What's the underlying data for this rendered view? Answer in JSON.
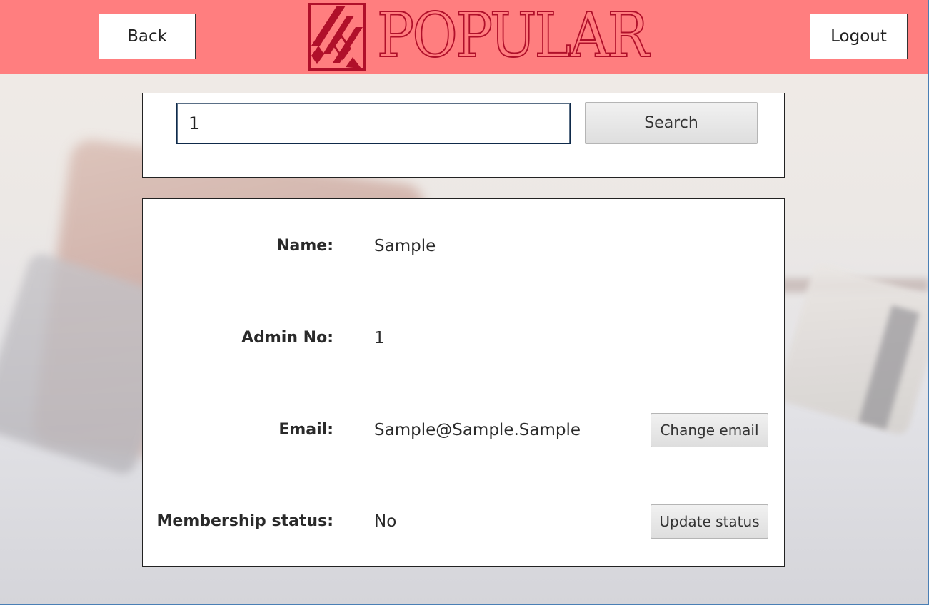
{
  "header": {
    "back_label": "Back",
    "logout_label": "Logout",
    "logo_text": "POPULAR",
    "logo_color": "#b0102a",
    "bar_color": "#ff7e7f"
  },
  "search": {
    "value": "1",
    "button_label": "Search"
  },
  "details": {
    "name": {
      "label": "Name:",
      "value": "Sample"
    },
    "admin_no": {
      "label": "Admin No:",
      "value": "1"
    },
    "email": {
      "label": "Email:",
      "value": "Sample@Sample.Sample",
      "action_label": "Change email"
    },
    "membership": {
      "label": "Membership status:",
      "value": "No",
      "action_label": "Update status"
    }
  }
}
